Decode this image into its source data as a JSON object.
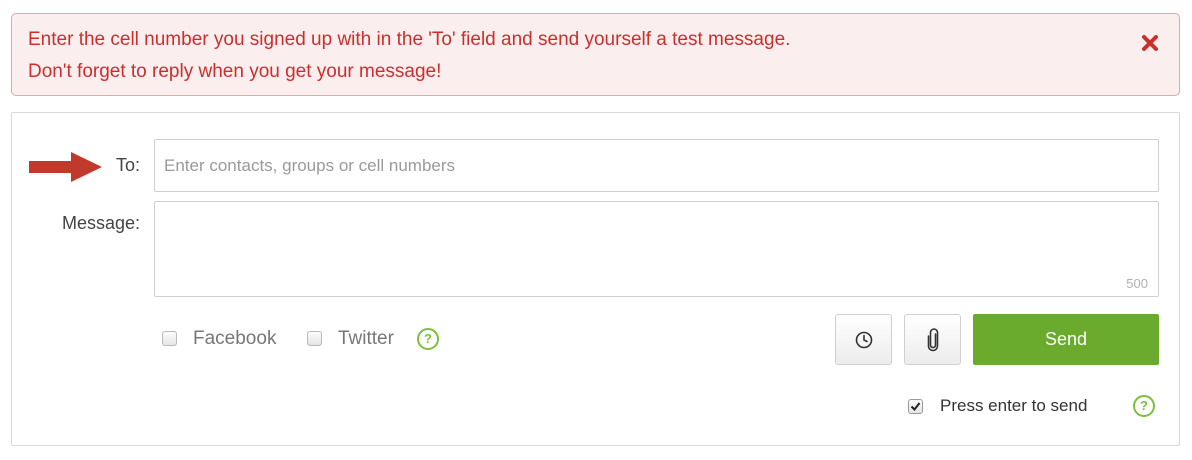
{
  "alert": {
    "line1": "Enter the cell number you signed up with in the 'To' field and send yourself a test message.",
    "line2": "Don't forget to reply when you get your message!",
    "close_icon": "close-x-icon",
    "color": "#c9302c"
  },
  "compose": {
    "to_label": "To:",
    "to_placeholder": "Enter contacts, groups or cell numbers",
    "to_value": "",
    "pointer_icon": "red-arrow-icon",
    "message_label": "Message:",
    "message_value": "",
    "char_count": "500",
    "facebook_label": "Facebook",
    "facebook_checked": false,
    "twitter_label": "Twitter",
    "twitter_checked": false,
    "help_symbol": "?",
    "schedule_icon": "clock-icon",
    "attach_icon": "paperclip-icon",
    "send_label": "Send",
    "send_color": "#6aab2e",
    "press_enter_label": "Press enter to send",
    "press_enter_checked": true
  }
}
